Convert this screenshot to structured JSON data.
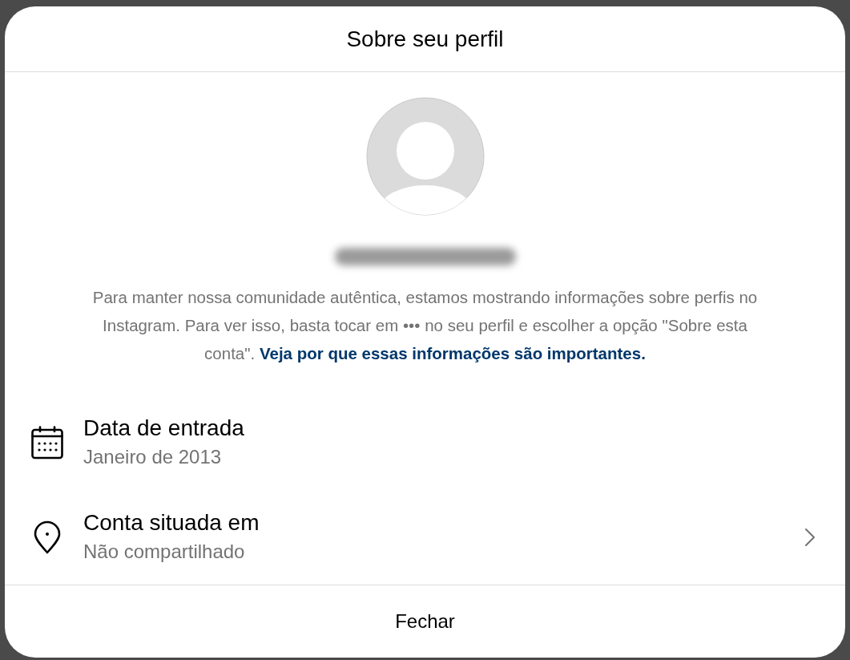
{
  "dialog": {
    "title": "Sobre seu perfil"
  },
  "description": {
    "text": "Para manter nossa comunidade autêntica, estamos mostrando informações sobre perfis no Instagram. Para ver isso, basta tocar em ••• no seu perfil e escolher a opção \"Sobre esta conta\".",
    "link": "Veja por que essas informações são importantes."
  },
  "details": [
    {
      "kind": "date",
      "label": "Data de entrada",
      "value": "Janeiro de 2013",
      "opens_detail": false
    },
    {
      "kind": "location",
      "label": "Conta situada em",
      "value": "Não compartilhado",
      "opens_detail": true
    }
  ],
  "buttons": [
    {
      "label": "Fechar"
    }
  ]
}
